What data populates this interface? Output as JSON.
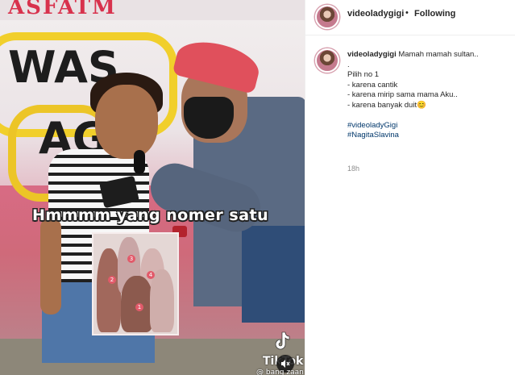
{
  "video": {
    "graffiti_top": "ASFATM",
    "graffiti_letters": "WAS",
    "graffiti_letters_2": "AGU",
    "caption": "Hmmmm yang nomer satu",
    "thumbnail_numbers": [
      "1",
      "2",
      "3",
      "4"
    ],
    "tiktok_label": "TikTok",
    "tiktok_handle": "@ bang zaan",
    "mute_icon": "speaker-muted-icon"
  },
  "post": {
    "header": {
      "username": "videoladygigi",
      "separator": "•",
      "follow_status": "Following"
    },
    "caption": {
      "username": "videoladygigi",
      "first_line": "Mamah mamah sultan..",
      "lines": [
        ".",
        "Pilih no 1",
        "- karena cantik",
        "- karena mirip sama mama Aku..",
        "- karena banyak duit😊"
      ],
      "hashtags": [
        "#videoladyGigi",
        "#NagitaSlavina"
      ],
      "time": "18h"
    }
  },
  "colors": {
    "hashtag": "#00376b",
    "text": "#262626",
    "muted": "#8e8e8e",
    "border": "#efefef"
  }
}
